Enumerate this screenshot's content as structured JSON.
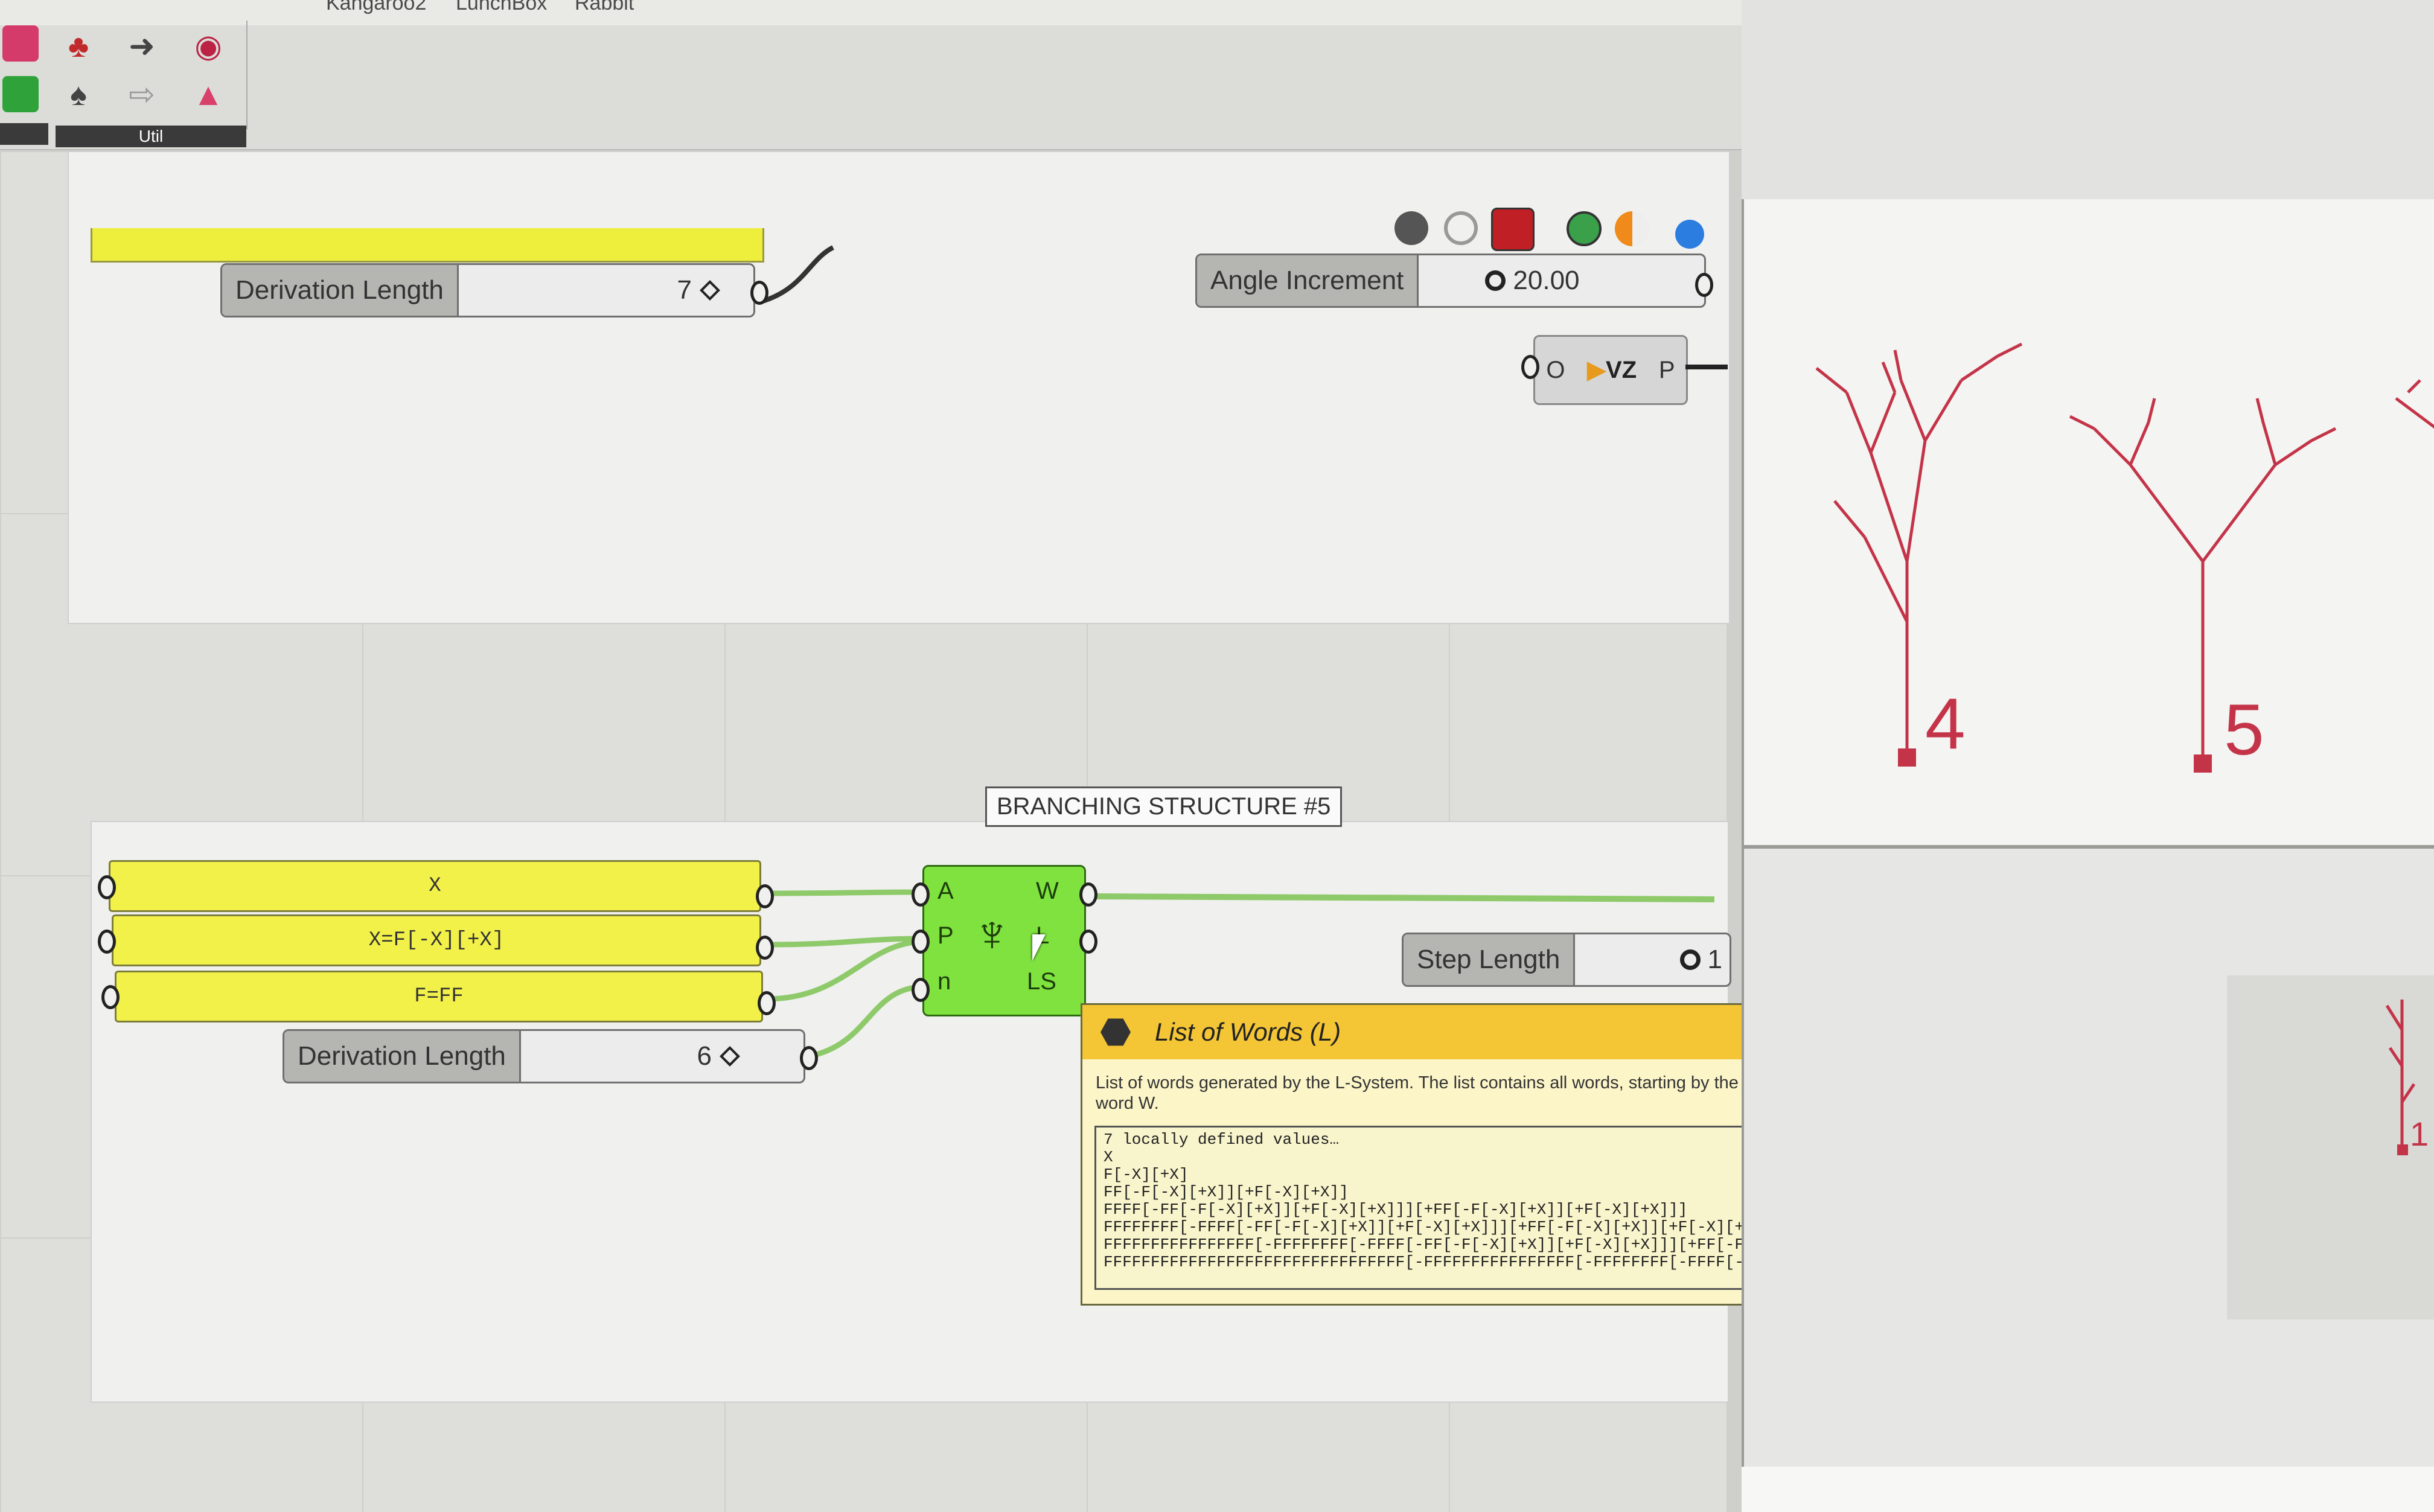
{
  "menu": {
    "items": [
      "Kangaroo2",
      "LunchBox",
      "Rabbit"
    ]
  },
  "ribbon": {
    "group_label": "Util"
  },
  "sliders": {
    "derivation_top": {
      "label": "Derivation Length",
      "value": "7"
    },
    "angle": {
      "label": "Angle Increment",
      "value": "20.00"
    },
    "derivation_bottom": {
      "label": "Derivation Length",
      "value": "6"
    },
    "step": {
      "label": "Step Length",
      "value": "1"
    }
  },
  "vector_component": {
    "in": "O",
    "mid": "VZ",
    "out": "P"
  },
  "panels": {
    "axiom": "X",
    "rule_x": "X=F[-X][+X]",
    "rule_f": "F=FF"
  },
  "name_tag": "BRANCHING STRUCTURE #5",
  "lsystem": {
    "inputs": [
      "A",
      "P",
      "n"
    ],
    "outputs": [
      "W",
      "L",
      "LS"
    ]
  },
  "tooltip": {
    "title": "List of Words (L)",
    "description": "List of words generated by the L-System. The list contains all words, starting by the axiom, ending with the last generated word W.",
    "values": [
      "7 locally defined values…",
      "X",
      "F[-X][+X]",
      "FF[-F[-X][+X]][+F[-X][+X]]",
      "FFFF[-FF[-F[-X][+X]][+F[-X][+X]]][+FF[-F[-X][+X]][+F[-X][+X]]]",
      "FFFFFFFF[-FFFF[-FF[-F[-X][+X]][+F[-X][+X]]][+FF[-F[-X][+X]][+F[-X][+X]]]][+FFFF[…",
      "FFFFFFFFFFFFFFFF[-FFFFFFFF[-FFFF[-FF[-F[-X][+X]][+F[-X][+X]]][+FF[-F[-X][+X]][+F…",
      "FFFFFFFFFFFFFFFFFFFFFFFFFFFFFFFF[-FFFFFFFFFFFFFFFF[-FFFFFFFF[-FFFF[-FF[-F[-X][+X…"
    ]
  },
  "viewport": {
    "labels": [
      "4",
      "5",
      "1"
    ]
  }
}
